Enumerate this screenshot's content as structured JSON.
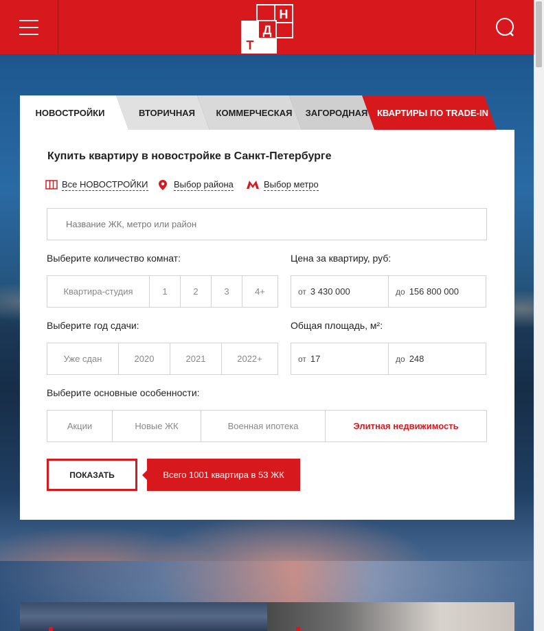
{
  "header": {
    "logo_letters": [
      "Т",
      "Д",
      "Н"
    ],
    "colors": {
      "brand": "#d7191e",
      "white": "#ffffff"
    },
    "menu_icon": "hamburger-icon",
    "search_icon": "search-icon"
  },
  "tabs": [
    {
      "label": "НОВОСТРОЙКИ",
      "active": true
    },
    {
      "label": "ВТОРИЧНАЯ"
    },
    {
      "label": "КОММЕРЧЕСКАЯ"
    },
    {
      "label": "ЗАГОРОДНАЯ"
    },
    {
      "label": "КВАРТИРЫ ПО TRADE-IN",
      "highlight": true
    }
  ],
  "panel": {
    "title": "Купить квартиру в новостройке в Санкт-Петербурге",
    "links": {
      "all": "Все НОВОСТРОЙКИ",
      "district": "Выбор района",
      "metro": "Выбор метро"
    },
    "search": {
      "placeholder": "Название ЖК, метро или район",
      "value": ""
    },
    "rooms": {
      "label": "Выберите количество комнат:",
      "options": [
        "Квартира-студия",
        "1",
        "2",
        "3",
        "4+"
      ]
    },
    "price": {
      "label": "Цена за квартиру, руб:",
      "from_prefix": "от",
      "from_value": "3 430 000",
      "to_prefix": "до",
      "to_value": "156 800 000"
    },
    "year": {
      "label": "Выберите год сдачи:",
      "options": [
        "Уже сдан",
        "2020",
        "2021",
        "2022+"
      ]
    },
    "area": {
      "label": "Общая площадь, м²:",
      "from_prefix": "от",
      "from_value": "17",
      "to_prefix": "до",
      "to_value": "248"
    },
    "features": {
      "label": "Выберите основные особенности:",
      "options": [
        "Акции",
        "Новые ЖК",
        "Военная ипотека",
        "Элитная недвижимость"
      ]
    },
    "show_button": "ПОКАЗАТЬ",
    "result_text": "Всего 1001 квартира в 53 ЖК"
  }
}
